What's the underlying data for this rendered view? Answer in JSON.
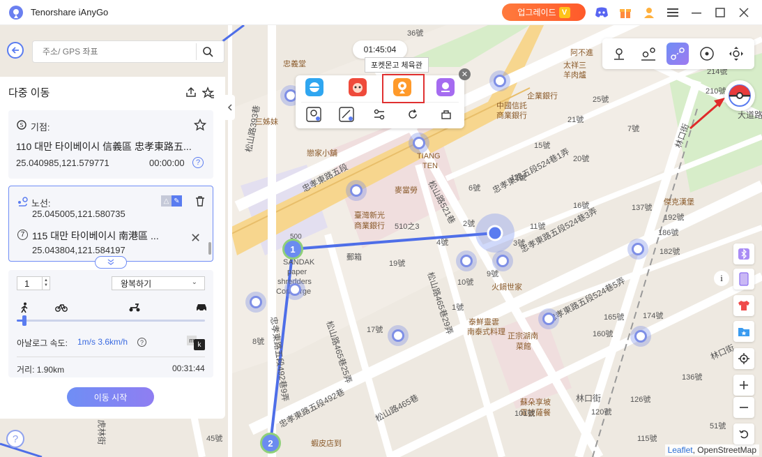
{
  "app": {
    "title": "Tenorshare iAnyGo",
    "upgrade_label": "업그레이드",
    "upgrade_badge": "V"
  },
  "search": {
    "placeholder": "주소/ GPS 좌표"
  },
  "panel": {
    "title": "다중 이동",
    "start": {
      "label": "기점:",
      "address": "110 대만 타이베이시 信義區 忠孝東路五...",
      "coords": "25.040985,121.579771",
      "time": "00:00:00"
    },
    "route": {
      "label": "노선:",
      "prev_coords": "25.045005,121.580735",
      "stop_number": "7",
      "stop_address": "115 대만 타이베이시 南港區 ...",
      "stop_coords": "25.043804,121.584197"
    },
    "settings": {
      "count": "1",
      "mode": "왕복하기",
      "speed_label": "아날로그 속도:",
      "speed_value": "1m/s 3.6km/h",
      "unit_m": "m",
      "unit_k": "k",
      "speed_fraction": 0.04
    },
    "distance": "거리: 1.90km",
    "duration": "00:31:44",
    "start_button": "이동 시작"
  },
  "popup": {
    "timer": "01:45:04",
    "tooltip": "포켓몬고 체육관"
  },
  "map": {
    "streets": [
      "忠孝東路五段",
      "忠孝東路五段524巷1弄",
      "忠孝東路五段524巷3弄",
      "忠孝東路五段524巷5弄",
      "忠孝東路五段492巷",
      "忠孝東路五段492巷9弄",
      "松山路465巷",
      "松山路465巷25弄",
      "松山路465巷29弄",
      "松山路521巷",
      "林口街",
      "大道路",
      "松山路393巷",
      "虎林街",
      "5弄",
      "7弄"
    ],
    "pois": [
      "阿不進",
      "太祥三",
      "羊肉爐",
      "中國信託",
      "商業銀行",
      "企業銀行",
      "臺灣新光",
      "商業銀行",
      "麥當勞",
      "郵箱",
      "火鍋世家",
      "泰鮮靈雲",
      "南泰式料理",
      "正宗湖南",
      "菜館",
      "蘇朵享坡",
      "電披薩餐",
      "傑克漢堡",
      "蝦皮店到",
      "SANDAK",
      "paper",
      "shredders",
      "Concierge",
      "戀家小舖",
      "三姊妹",
      "忠義堂",
      "TIANG",
      "TEN"
    ],
    "house_numbers": [
      "36號",
      "25號",
      "21號",
      "20號",
      "19號",
      "17號",
      "16號",
      "15號",
      "12號",
      "11號",
      "10號",
      "9號",
      "8號",
      "7號",
      "6號",
      "5號",
      "4號",
      "3號",
      "2號",
      "1號",
      "214號",
      "210號",
      "192號",
      "186號",
      "182號",
      "174號",
      "165號",
      "160號",
      "137號",
      "136號",
      "126號",
      "120號",
      "115號",
      "101號",
      "51號",
      "45號",
      "510之3",
      "500"
    ],
    "waypoints": [
      "1",
      "2"
    ],
    "attribution_leaflet": "Leaflet",
    "attribution_osm": ", OpenStreetMap"
  },
  "colors": {
    "accent": "#5a7cf0",
    "route": "#4e6ee8",
    "upgrade": "#ff6a32",
    "highlight": "#e03030"
  }
}
